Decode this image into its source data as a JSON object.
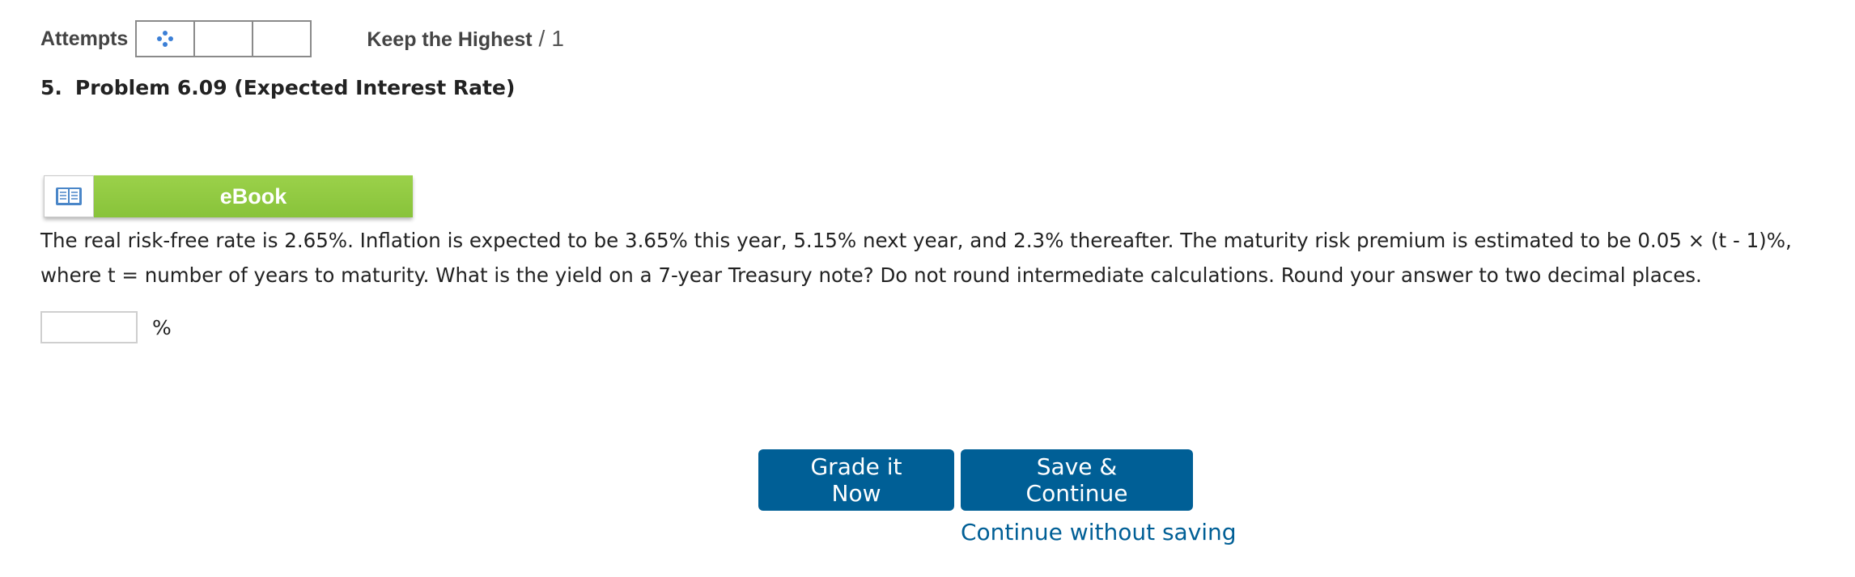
{
  "attempts": {
    "label": "Attempts",
    "boxes": [
      "",
      "",
      ""
    ],
    "loading_icon": "spinner-dots-icon",
    "keep_label": "Keep the Highest",
    "separator": "/",
    "total": "1"
  },
  "problem": {
    "number": "5.",
    "title": "Problem 6.09 (Expected Interest Rate)"
  },
  "ebook": {
    "icon": "open-book-icon",
    "label": "eBook"
  },
  "question": {
    "line1": "The real risk-free rate is 2.65%. Inflation is expected to be 3.65% this year, 5.15% next year, and 2.3% thereafter. The maturity risk premium is estimated to be 0.05 × (t - 1)%,",
    "line2": "where t = number of years to maturity. What is the yield on a 7-year Treasury note? Do not round intermediate calculations. Round your answer to two decimal places."
  },
  "answer": {
    "value": "",
    "unit": "%"
  },
  "buttons": {
    "grade": "Grade it Now",
    "save": "Save & Continue",
    "continue": "Continue without saving"
  },
  "colors": {
    "primary_button": "#005f96",
    "ebook_green": "#8dc63f",
    "link": "#005f96"
  }
}
